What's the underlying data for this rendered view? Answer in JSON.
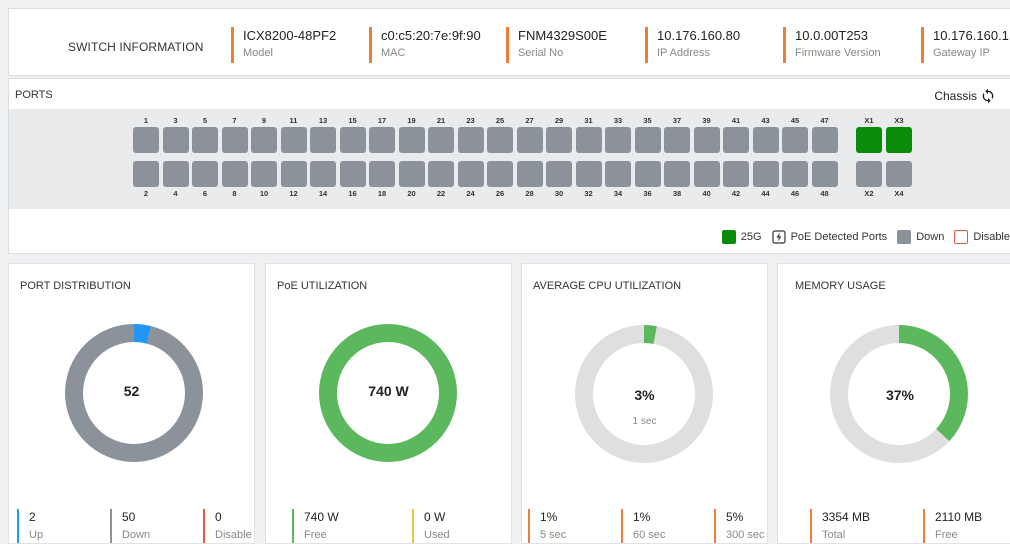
{
  "colors": {
    "accent": "#ee7d3a",
    "port_down": "#8b9299",
    "port_up": "#0a8c0a",
    "blue": "#2196f3",
    "green": "#5cb85c",
    "light_gray": "#dfdfdf",
    "yellow": "#f0c040",
    "red": "#e05a40"
  },
  "switch_info": {
    "title": "SWITCH INFORMATION",
    "fields": [
      {
        "value": "ICX8200-48PF2",
        "label": "Model"
      },
      {
        "value": "c0:c5:20:7e:9f:90",
        "label": "MAC"
      },
      {
        "value": "FNM4329S00E",
        "label": "Serial No"
      },
      {
        "value": "10.176.160.80",
        "label": "IP Address"
      },
      {
        "value": "10.0.00T253",
        "label": "Firmware Version"
      },
      {
        "value": "10.176.160.1",
        "label": "Gateway IP"
      }
    ]
  },
  "ports": {
    "title": "PORTS",
    "chassis_label": "Chassis",
    "chassis_icon": "refresh-icon",
    "top_numbers": [
      "1",
      "3",
      "5",
      "7",
      "9",
      "11",
      "13",
      "15",
      "17",
      "19",
      "21",
      "23",
      "25",
      "27",
      "29",
      "31",
      "33",
      "35",
      "37",
      "39",
      "41",
      "43",
      "45",
      "47"
    ],
    "bottom_numbers": [
      "2",
      "4",
      "6",
      "8",
      "10",
      "12",
      "14",
      "16",
      "18",
      "20",
      "22",
      "24",
      "26",
      "28",
      "30",
      "32",
      "34",
      "36",
      "38",
      "40",
      "42",
      "44",
      "46",
      "48"
    ],
    "uplink_top": [
      {
        "label": "X1",
        "status": "up"
      },
      {
        "label": "X3",
        "status": "up"
      }
    ],
    "uplink_bottom": [
      {
        "label": "X2",
        "status": "down"
      },
      {
        "label": "X4",
        "status": "down"
      }
    ],
    "legend": {
      "speed": "25G",
      "poe": "PoE Detected Ports",
      "down": "Down",
      "disabled": "Disable"
    }
  },
  "cards": {
    "port_distribution": {
      "title": "PORT DISTRIBUTION",
      "center": "52",
      "ring": [
        {
          "fraction": 0.04,
          "color": "#2196f3"
        },
        {
          "fraction": 0.96,
          "color": "#8b9299"
        }
      ],
      "stats": [
        {
          "value": "2",
          "label": "Up",
          "color": "#2196f3"
        },
        {
          "value": "50",
          "label": "Down",
          "color": "#8b9299"
        },
        {
          "value": "0",
          "label": "Disable",
          "color": "#e05a40"
        }
      ]
    },
    "poe_utilization": {
      "title": "PoE UTILIZATION",
      "center": "740 W",
      "ring": [
        {
          "fraction": 1.0,
          "color": "#5cb85c"
        }
      ],
      "stats": [
        {
          "value": "740 W",
          "label": "Free",
          "color": "#5cb85c"
        },
        {
          "value": "0 W",
          "label": "Used",
          "color": "#f0c040"
        }
      ]
    },
    "cpu_utilization": {
      "title": "AVERAGE CPU UTILIZATION",
      "center": "3%",
      "sub": "1 sec",
      "ring": [
        {
          "fraction": 0.03,
          "color": "#5cb85c"
        },
        {
          "fraction": 0.97,
          "color": "#dfdfdf"
        }
      ],
      "stats": [
        {
          "value": "1%",
          "label": "5 sec",
          "color": "#ee7d3a"
        },
        {
          "value": "1%",
          "label": "60 sec",
          "color": "#ee7d3a"
        },
        {
          "value": "5%",
          "label": "300 sec",
          "color": "#ee7d3a"
        }
      ]
    },
    "memory_usage": {
      "title": "MEMORY USAGE",
      "center": "37%",
      "ring": [
        {
          "fraction": 0.37,
          "color": "#5cb85c"
        },
        {
          "fraction": 0.63,
          "color": "#dfdfdf"
        }
      ],
      "stats": [
        {
          "value": "3354 MB",
          "label": "Total",
          "color": "#ee7d3a"
        },
        {
          "value": "2110 MB",
          "label": "Free",
          "color": "#ee7d3a"
        }
      ]
    }
  }
}
